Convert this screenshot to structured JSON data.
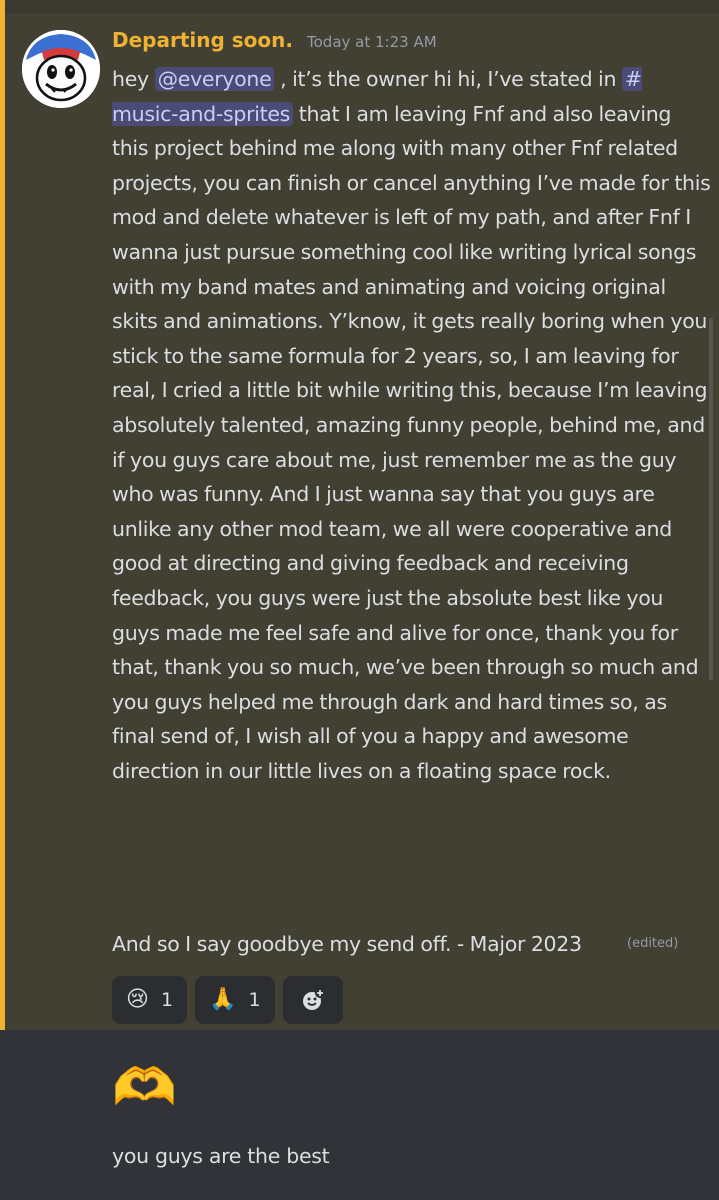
{
  "message": {
    "author": "Departing soon.",
    "timestamp": "Today at 1:23 AM",
    "body": {
      "part1": "hey ",
      "mention_everyone": "@everyone",
      "part2": " , it’s the owner hi hi, I’ve stated in ",
      "channel_mention": "# music-and-sprites",
      "part3": " that I am leaving Fnf and also leaving this project behind me along with many other Fnf related projects, you can finish or cancel anything I’ve made for this mod and delete whatever is left of my path, and after Fnf I wanna just pursue something cool like writing lyrical songs with my band mates and animating and voicing original skits and animations. Y’know, it gets really boring when you stick to the same formula for 2 years, so, I am leaving for real, I cried a little bit while writing this, because I’m leaving absolutely talented, amazing funny people, behind me, and if you guys care about me, just remember me as the guy who was funny. And I just wanna say that you guys are unlike any other mod team, we all were cooperative and good at directing and giving feedback and receiving feedback, you guys were just the absolute best like you guys made me feel safe and alive for once, thank you for that, thank you so much, we’ve been through so much and you guys helped me through dark and hard times so, as final send of, I wish all of you a happy and awesome direction in our little lives on a floating space rock.",
      "final_line": "And so I say goodbye my send off. - Major 2023",
      "edited": "(edited)"
    },
    "reactions": [
      {
        "emoji": "😢",
        "count": "1"
      },
      {
        "emoji": "🙏",
        "count": "1"
      }
    ],
    "add_reaction_icon": "add-reaction-icon"
  },
  "followup": {
    "emoji": "🫶",
    "text": "you guys are the best"
  },
  "colors": {
    "highlight_bg": "#423f33",
    "highlight_bar": "#f0b232",
    "username": "#f0b232",
    "background": "#313338"
  }
}
